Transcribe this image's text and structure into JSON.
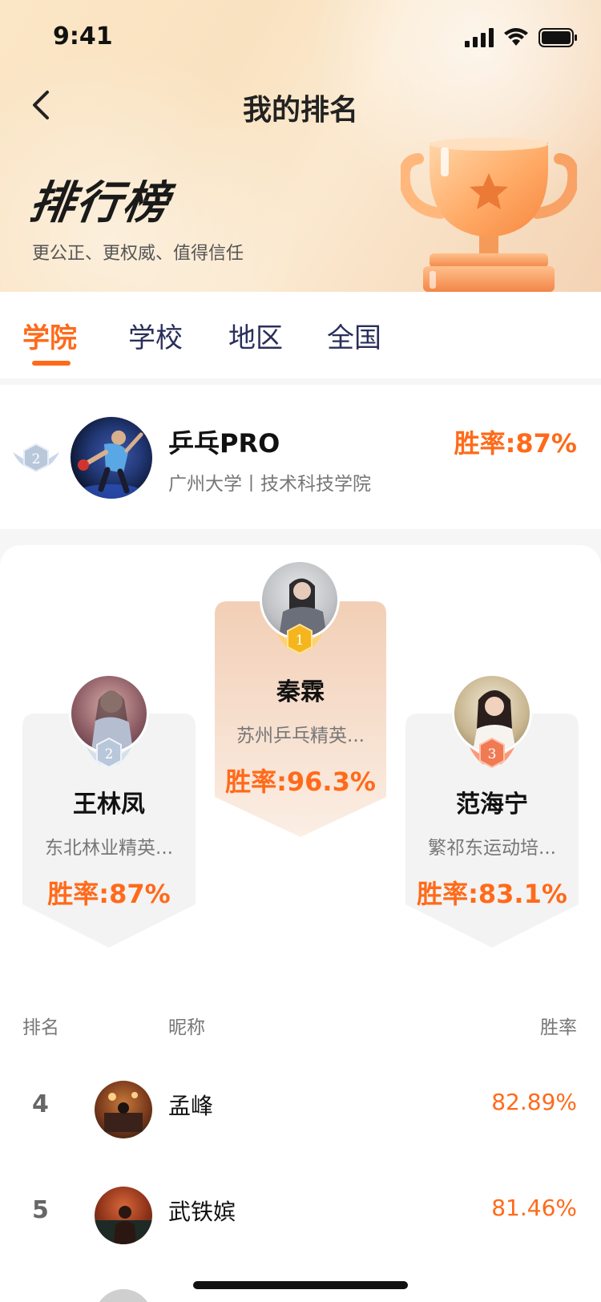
{
  "status_bar": {
    "time": "9:41"
  },
  "nav": {
    "title": "我的排名"
  },
  "hero": {
    "title": "排行榜",
    "subtitle": "更公正、更权威、值得信任"
  },
  "tabs": [
    {
      "label": "学院",
      "active": true
    },
    {
      "label": "学校",
      "active": false
    },
    {
      "label": "地区",
      "active": false
    },
    {
      "label": "全国",
      "active": false
    }
  ],
  "my_rank": {
    "badge_number": "2",
    "name": "乒乓PRO",
    "school": "广州大学丨技术科技学院",
    "win_rate": "胜率:87%"
  },
  "podium": {
    "first": {
      "medal": "1",
      "name": "秦霖",
      "sub": "苏州乒乓精英...",
      "win_rate": "胜率:96.3%"
    },
    "second": {
      "medal": "2",
      "name": "王林凤",
      "sub": "东北林业精英...",
      "win_rate": "胜率:87%"
    },
    "third": {
      "medal": "3",
      "name": "范海宁",
      "sub": "繁祁东运动培...",
      "win_rate": "胜率:83.1%"
    }
  },
  "list": {
    "headers": {
      "rank": "排名",
      "nickname": "昵称",
      "win_rate": "胜率"
    },
    "rows": [
      {
        "rank": "4",
        "name": "孟峰",
        "win_rate": "82.89%"
      },
      {
        "rank": "5",
        "name": "武铁嫔",
        "win_rate": "81.46%"
      }
    ]
  },
  "colors": {
    "accent": "#ff6a1a",
    "tab_inactive": "#2a2f5b",
    "gold": "#f5b51d",
    "silver": "#b8c7da",
    "bronze": "#f07a54"
  }
}
